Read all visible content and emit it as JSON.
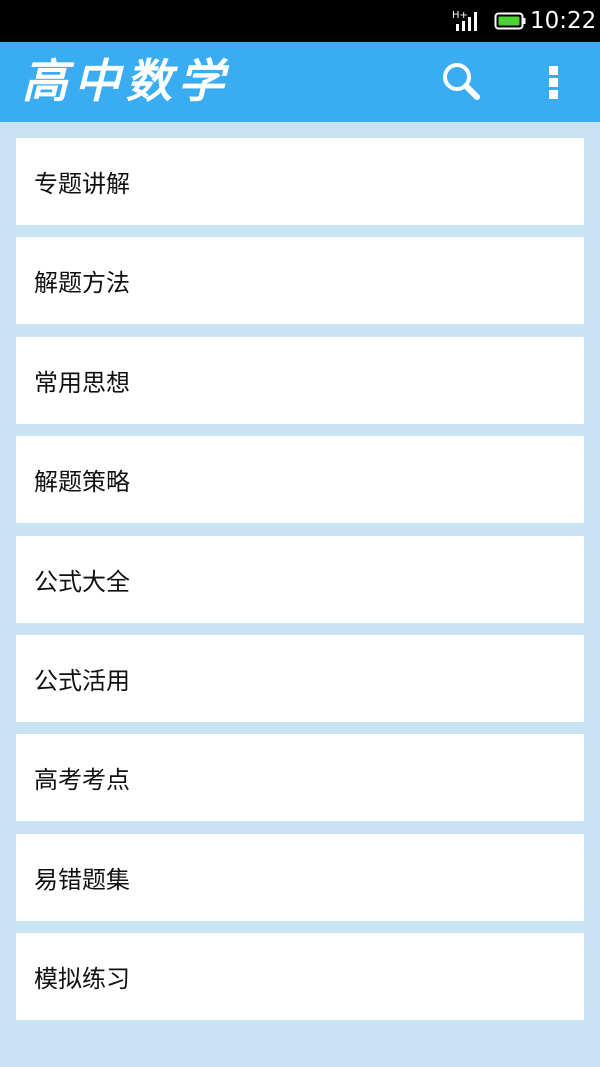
{
  "status_bar": {
    "network_label": "H+",
    "time": "10:22"
  },
  "app_bar": {
    "title": "高中数学",
    "icons": [
      "search-icon",
      "overflow-menu-icon"
    ]
  },
  "menu": {
    "items": [
      {
        "label": "专题讲解"
      },
      {
        "label": "解题方法"
      },
      {
        "label": "常用思想"
      },
      {
        "label": "解题策略"
      },
      {
        "label": "公式大全"
      },
      {
        "label": "公式活用"
      },
      {
        "label": "高考考点"
      },
      {
        "label": "易错题集"
      },
      {
        "label": "模拟练习"
      }
    ]
  },
  "colors": {
    "status_bar": "#000000",
    "app_bar": "#3aacf2",
    "background": "#c9e2f4",
    "item_background": "#ffffff",
    "battery": "#4cd137"
  }
}
